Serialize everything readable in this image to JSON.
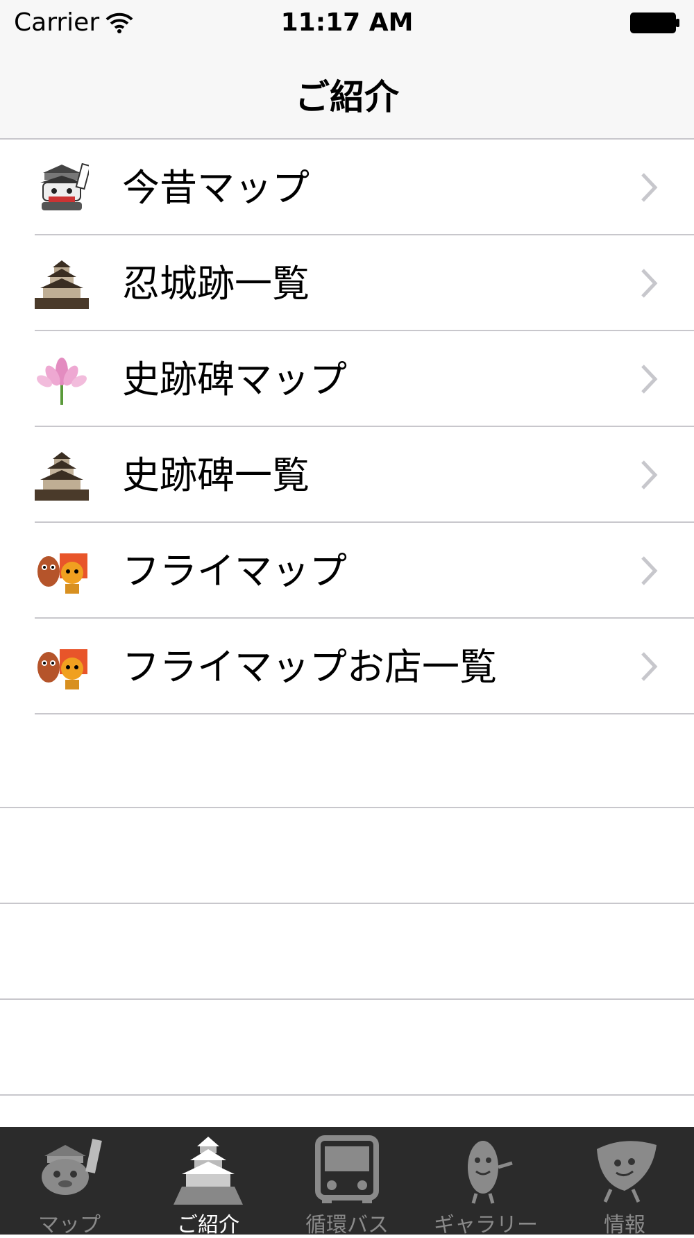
{
  "status_bar": {
    "carrier": "Carrier",
    "time": "11:17 AM"
  },
  "nav": {
    "title": "ご紹介"
  },
  "rows": [
    {
      "label": "今昔マップ",
      "icon": "mascot-castle-icon"
    },
    {
      "label": "忍城跡一覧",
      "icon": "castle-icon"
    },
    {
      "label": "史跡碑マップ",
      "icon": "lotus-icon"
    },
    {
      "label": "史跡碑一覧",
      "icon": "castle-icon"
    },
    {
      "label": "フライマップ",
      "icon": "fry-mascots-icon"
    },
    {
      "label": "フライマップお店一覧",
      "icon": "fry-mascots-icon"
    }
  ],
  "tabs": [
    {
      "label": "マップ",
      "icon": "mascot-map-icon",
      "selected": false
    },
    {
      "label": "ご紹介",
      "icon": "castle-tab-icon",
      "selected": true
    },
    {
      "label": "循環バス",
      "icon": "bus-icon",
      "selected": false
    },
    {
      "label": "ギャラリー",
      "icon": "bean-mascot-icon",
      "selected": false
    },
    {
      "label": "情報",
      "icon": "leaf-mascot-icon",
      "selected": false
    }
  ]
}
